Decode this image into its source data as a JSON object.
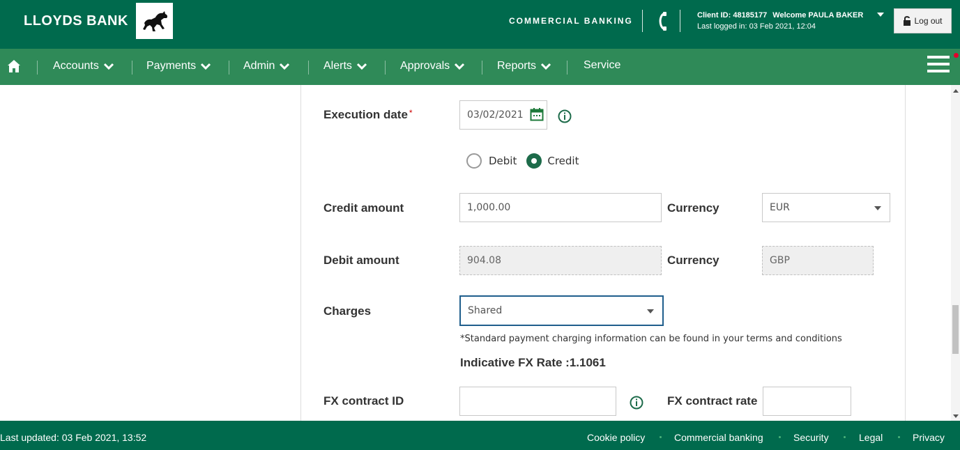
{
  "header": {
    "brand": "LLOYDS BANK",
    "section": "COMMERCIAL BANKING",
    "client_id": "Client ID: 48185177",
    "welcome": "Welcome PAULA BAKER",
    "last_logged": "Last logged in: 03 Feb 2021, 12:04",
    "logout_label": "Log out",
    "icons": [
      "horse-logo-icon",
      "phone-icon",
      "user-menu-caret-icon",
      "padlock-icon"
    ]
  },
  "nav": {
    "items": [
      {
        "label": "Accounts"
      },
      {
        "label": "Payments"
      },
      {
        "label": "Admin"
      },
      {
        "label": "Alerts"
      },
      {
        "label": "Approvals"
      },
      {
        "label": "Reports"
      },
      {
        "label": "Service"
      }
    ]
  },
  "form": {
    "execution_date": {
      "label": "Execution date",
      "required_mark": "*",
      "value": "03/02/2021"
    },
    "direction": {
      "options": [
        "Debit",
        "Credit"
      ],
      "selected": "Credit"
    },
    "credit_amount": {
      "label": "Credit amount",
      "value": "1,000.00"
    },
    "credit_currency": {
      "label": "Currency",
      "value": "EUR"
    },
    "debit_amount": {
      "label": "Debit amount",
      "value": "904.08"
    },
    "debit_currency": {
      "label": "Currency",
      "value": "GBP"
    },
    "charges": {
      "label": "Charges",
      "value": "Shared"
    },
    "charges_note": "*Standard payment charging information can be found in your terms and conditions",
    "fx_rate": "Indicative FX Rate :1.1061",
    "fx_contract_id": {
      "label": "FX contract ID",
      "value": ""
    },
    "fx_contract_rate": {
      "label": "FX contract rate",
      "value": ""
    }
  },
  "footer": {
    "last_updated": "Last updated: 03 Feb 2021, 13:52",
    "links": [
      "Cookie policy",
      "Commercial banking",
      "Security",
      "Legal",
      "Privacy"
    ]
  },
  "colors": {
    "header_green": "#006a4d",
    "nav_green": "#2f8a58",
    "accent_green": "#1d6b4a",
    "focus_blue": "#1f5e8c"
  }
}
